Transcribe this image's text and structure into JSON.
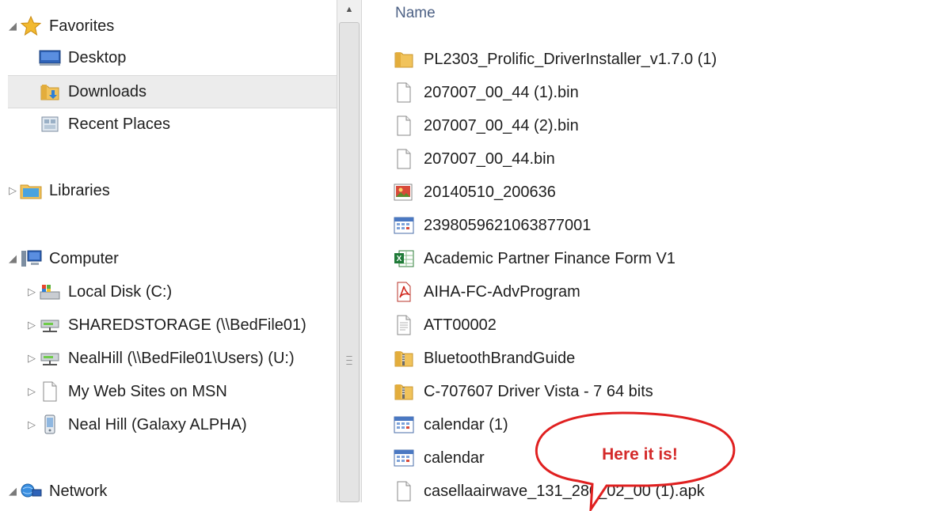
{
  "nav": {
    "items": [
      {
        "label": "Favorites",
        "icon": "star-icon",
        "arrow": "◢",
        "indent": 0,
        "selected": false
      },
      {
        "label": "Desktop",
        "icon": "desktop-icon",
        "arrow": "",
        "indent": 1,
        "selected": false
      },
      {
        "label": "Downloads",
        "icon": "downloads-folder-icon",
        "arrow": "",
        "indent": 1,
        "selected": true
      },
      {
        "label": "Recent Places",
        "icon": "recent-places-icon",
        "arrow": "",
        "indent": 1,
        "selected": false
      },
      {
        "label": "Libraries",
        "icon": "libraries-icon",
        "arrow": "▷",
        "indent": 0,
        "selected": false
      },
      {
        "label": "Computer",
        "icon": "computer-icon",
        "arrow": "◢",
        "indent": 0,
        "selected": false
      },
      {
        "label": "Local Disk (C:)",
        "icon": "local-disk-icon",
        "arrow": "▷",
        "indent": 1,
        "selected": false
      },
      {
        "label": "SHAREDSTORAGE (\\\\BedFile01)",
        "icon": "network-drive-icon",
        "arrow": "▷",
        "indent": 1,
        "selected": false
      },
      {
        "label": "NealHill (\\\\BedFile01\\Users) (U:)",
        "icon": "network-drive-icon",
        "arrow": "▷",
        "indent": 1,
        "selected": false
      },
      {
        "label": "My Web Sites on MSN",
        "icon": "blank-file-icon",
        "arrow": "▷",
        "indent": 1,
        "selected": false
      },
      {
        "label": "Neal Hill (Galaxy ALPHA)",
        "icon": "phone-icon",
        "arrow": "▷",
        "indent": 1,
        "selected": false
      },
      {
        "label": "Network",
        "icon": "network-icon",
        "arrow": "◢",
        "indent": 0,
        "selected": false
      }
    ]
  },
  "files": {
    "column_name": "Name",
    "items": [
      {
        "name": "PL2303_Prolific_DriverInstaller_v1.7.0 (1)",
        "icon": "folder-icon"
      },
      {
        "name": "207007_00_44 (1).bin",
        "icon": "blank-file-icon"
      },
      {
        "name": "207007_00_44 (2).bin",
        "icon": "blank-file-icon"
      },
      {
        "name": "207007_00_44.bin",
        "icon": "blank-file-icon"
      },
      {
        "name": "20140510_200636",
        "icon": "image-file-icon"
      },
      {
        "name": "2398059621063877001",
        "icon": "calendar-file-icon"
      },
      {
        "name": "Academic Partner Finance Form V1",
        "icon": "excel-file-icon"
      },
      {
        "name": "AIHA-FC-AdvProgram",
        "icon": "pdf-file-icon"
      },
      {
        "name": "ATT00002",
        "icon": "text-file-icon"
      },
      {
        "name": "BluetoothBrandGuide",
        "icon": "zip-folder-icon"
      },
      {
        "name": "C-707607 Driver Vista - 7 64 bits",
        "icon": "zip-folder-icon"
      },
      {
        "name": "calendar (1)",
        "icon": "calendar-file-icon"
      },
      {
        "name": "calendar",
        "icon": "calendar-file-icon"
      },
      {
        "name": "casellaairwave_131_280_02_00 (1).apk",
        "icon": "blank-file-icon"
      }
    ]
  },
  "callout": {
    "text": "Here it is!",
    "color": "#e02020"
  },
  "colors": {
    "header": "#4d6185",
    "selected_bg": "#ececec",
    "folder": "#e8b64a",
    "accent_red": "#d42a2a"
  }
}
